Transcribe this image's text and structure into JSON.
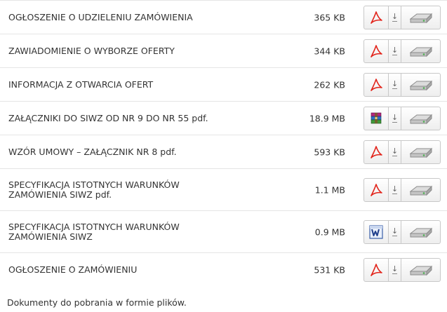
{
  "files": [
    {
      "name": "OGŁOSZENIE O UDZIELENIU ZAMÓWIENIA",
      "size": "365 KB",
      "type_icon": "pdf-icon"
    },
    {
      "name": "ZAWIADOMIENIE O WYBORZE OFERTY",
      "size": "344 KB",
      "type_icon": "pdf-icon"
    },
    {
      "name": "INFORMACJA Z OTWARCIA OFERT",
      "size": "262 KB",
      "type_icon": "pdf-icon"
    },
    {
      "name": "ZAŁĄCZNIKI DO SIWZ OD NR 9 DO NR 55 pdf.",
      "size": "18.9 MB",
      "type_icon": "archive-icon"
    },
    {
      "name": "WZÓR UMOWY – ZAŁĄCZNIK NR 8 pdf.",
      "size": "593 KB",
      "type_icon": "pdf-icon"
    },
    {
      "name": "SPECYFIKACJA ISTOTNYCH WARUNKÓW ZAMÓWIENIA SIWZ pdf.",
      "size": "1.1 MB",
      "type_icon": "pdf-icon"
    },
    {
      "name": "SPECYFIKACJA ISTOTNYCH WARUNKÓW ZAMÓWIENIA SIWZ",
      "size": "0.9 MB",
      "type_icon": "word-icon"
    },
    {
      "name": "OGŁOSZENIE O ZAMÓWIENIU",
      "size": "531 KB",
      "type_icon": "pdf-icon"
    }
  ],
  "footer": {
    "note": "Dokumenty do pobrania w formie plików."
  },
  "colors": {
    "pdf_red": "#e2231a",
    "border": "#c8c8c8",
    "text": "#333333"
  }
}
